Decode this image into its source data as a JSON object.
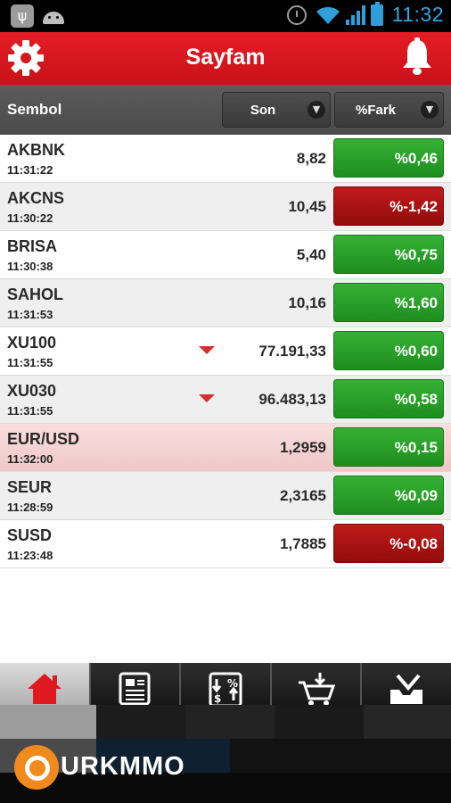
{
  "status_bar": {
    "time": "11:32",
    "icons": [
      "usb-icon",
      "android-icon",
      "alarm-icon",
      "wifi-icon",
      "signal-icon",
      "battery-icon"
    ]
  },
  "app_bar": {
    "title": "Sayfam",
    "left_icon": "gear-icon",
    "right_icon": "bell-icon"
  },
  "columns": {
    "symbol_label": "Sembol",
    "last_label": "Son",
    "change_label": "%Fark"
  },
  "rows": [
    {
      "symbol": "AKBNK",
      "time": "11:31:22",
      "last": "8,82",
      "change": "%0,46",
      "direction": "up",
      "arrow": false
    },
    {
      "symbol": "AKCNS",
      "time": "11:30:22",
      "last": "10,45",
      "change": "%-1,42",
      "direction": "down",
      "arrow": false
    },
    {
      "symbol": "BRISA",
      "time": "11:30:38",
      "last": "5,40",
      "change": "%0,75",
      "direction": "up",
      "arrow": false
    },
    {
      "symbol": "SAHOL",
      "time": "11:31:53",
      "last": "10,16",
      "change": "%1,60",
      "direction": "up",
      "arrow": false
    },
    {
      "symbol": "XU100",
      "time": "11:31:55",
      "last": "77.191,33",
      "change": "%0,60",
      "direction": "up",
      "arrow": true
    },
    {
      "symbol": "XU030",
      "time": "11:31:55",
      "last": "96.483,13",
      "change": "%0,58",
      "direction": "up",
      "arrow": true
    },
    {
      "symbol": "EUR/USD",
      "time": "11:32:00",
      "last": "1,2959",
      "change": "%0,15",
      "direction": "up",
      "arrow": false,
      "highlight": true
    },
    {
      "symbol": "SEUR",
      "time": "11:28:59",
      "last": "2,3165",
      "change": "%0,09",
      "direction": "up",
      "arrow": false
    },
    {
      "symbol": "SUSD",
      "time": "11:23:48",
      "last": "1,7885",
      "change": "%-0,08",
      "direction": "down",
      "arrow": false
    }
  ],
  "tabs": [
    {
      "icon": "home-icon",
      "active": true
    },
    {
      "icon": "news-icon",
      "active": false
    },
    {
      "icon": "percent-arrows-icon",
      "active": false
    },
    {
      "icon": "cart-icon",
      "active": false
    },
    {
      "icon": "inbox-icon",
      "active": false
    }
  ],
  "watermark": {
    "text": "URKMMO"
  },
  "colors": {
    "app_bar": "#d8141d",
    "up": "#28a028",
    "down": "#a81212",
    "header": "#505050"
  }
}
